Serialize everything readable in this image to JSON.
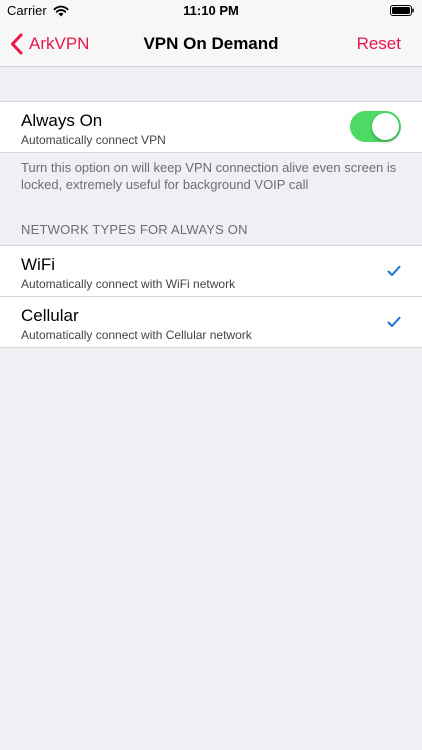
{
  "status_bar": {
    "carrier": "Carrier",
    "time": "11:10 PM"
  },
  "nav": {
    "back_label": "ArkVPN",
    "title": "VPN On Demand",
    "reset_label": "Reset"
  },
  "always_on": {
    "title": "Always On",
    "subtitle": "Automatically connect VPN",
    "enabled": true,
    "footer": "Turn this option on will keep VPN connection alive even screen is locked, extremely useful for background VOIP call"
  },
  "network_types": {
    "header": "NETWORK TYPES FOR ALWAYS ON",
    "items": [
      {
        "title": "WiFi",
        "subtitle": "Automatically connect with WiFi network",
        "checked": true
      },
      {
        "title": "Cellular",
        "subtitle": "Automatically connect with Cellular network",
        "checked": true
      }
    ]
  },
  "colors": {
    "accent": "#e8174b",
    "toggle_on": "#4cd964",
    "check": "#1a73d9",
    "background": "#efeff4"
  },
  "icons": {
    "status": [
      "wifi-icon",
      "battery-icon"
    ],
    "nav": [
      "back-chevron-icon"
    ],
    "list": [
      "checkmark-icon"
    ]
  }
}
